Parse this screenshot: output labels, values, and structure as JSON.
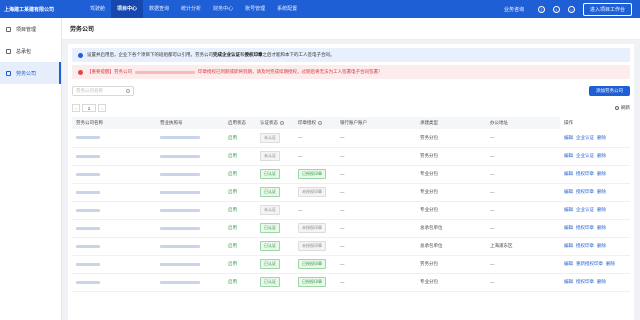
{
  "app": {
    "brand": "上海建工某建有限公司"
  },
  "topnav": [
    {
      "label": "驾驶舱",
      "active": false
    },
    {
      "label": "项目中心",
      "active": true
    },
    {
      "label": "数据查询",
      "active": false
    },
    {
      "label": "统计分析",
      "active": false
    },
    {
      "label": "财务中心",
      "active": false
    },
    {
      "label": "账号管理",
      "active": false
    },
    {
      "label": "系统配置",
      "active": false
    }
  ],
  "topright": {
    "link": "业务咨询",
    "enter_button": "进入项目工作台"
  },
  "sidebar": {
    "items": [
      {
        "label": "项目管理",
        "active": false
      },
      {
        "label": "总承包",
        "active": false
      },
      {
        "label": "劳务公司",
        "active": true
      }
    ]
  },
  "page": {
    "title": "劳务公司"
  },
  "alerts": {
    "info_pre": "设置并启用后，企业下各个项目下的班组都可以引用。劳务公司",
    "info_bold1": "完成企业认证",
    "info_mid": "和",
    "info_bold2": "授权印章",
    "info_post": "之后才能和本下的工人签电子合同。",
    "warn_pre": "【重要提醒】劳务公司",
    "warn_post": "印章授权已到期或即将到期，请及时完成续期授权，过期后将无法为工人签署电子合同签署！"
  },
  "toolbar": {
    "search_placeholder": "劳务公司名称",
    "add_button": "添加劳务公司"
  },
  "pager": {
    "page": "1"
  },
  "refresh": "刷新",
  "table": {
    "headers": [
      "劳务公司名称",
      "营业执照号",
      "启用状态",
      "认证状态",
      "印章授权",
      "银行账户账户",
      "承建类型",
      "办公地址",
      "操作"
    ],
    "rows": [
      {
        "status": "启用",
        "cert": "未认证",
        "seal": "---",
        "bank": "---",
        "type": "劳务分包",
        "addr": "---",
        "ops": [
          "编辑",
          "企业认证",
          "删除"
        ]
      },
      {
        "status": "启用",
        "cert": "未认证",
        "seal": "---",
        "bank": "---",
        "type": "劳务分包",
        "addr": "---",
        "ops": [
          "编辑",
          "企业认证",
          "删除"
        ]
      },
      {
        "status": "启用",
        "cert": "已认证",
        "seal": "已授权印章",
        "bank": "---",
        "type": "专业分包",
        "addr": "---",
        "ops": [
          "编辑",
          "授权印章",
          "删除"
        ]
      },
      {
        "status": "启用",
        "cert": "已认证",
        "seal": "未授权印章",
        "bank": "---",
        "type": "专业分包",
        "addr": "---",
        "ops": [
          "编辑",
          "授权印章",
          "删除"
        ]
      },
      {
        "status": "启用",
        "cert": "未认证",
        "seal": "---",
        "bank": "---",
        "type": "专业分包",
        "addr": "---",
        "ops": [
          "编辑",
          "企业认证",
          "删除"
        ]
      },
      {
        "status": "启用",
        "cert": "已认证",
        "seal": "未授权印章",
        "bank": "---",
        "type": "总承包单位",
        "addr": "---",
        "ops": [
          "编辑",
          "授权印章",
          "删除"
        ]
      },
      {
        "status": "启用",
        "cert": "已认证",
        "seal": "未授权印章",
        "bank": "---",
        "type": "总承包单位",
        "addr": "上海浦东区",
        "ops": [
          "编辑",
          "授权印章",
          "删除"
        ]
      },
      {
        "status": "启用",
        "cert": "已认证",
        "seal": "已授权印章",
        "bank": "---",
        "type": "劳务分包",
        "addr": "---",
        "ops": [
          "编辑",
          "重新授权印章",
          "删除"
        ]
      },
      {
        "status": "启用",
        "cert": "已认证",
        "seal": "已授权印章",
        "bank": "---",
        "type": "专业分包",
        "addr": "---",
        "ops": [
          "编辑",
          "授权印章",
          "删除"
        ]
      }
    ]
  },
  "colors": {
    "primary": "#1e5fd6",
    "success": "#2e9e3a",
    "danger": "#d9363e"
  },
  "icons": [
    "help-icon",
    "bell-icon",
    "user-icon",
    "search-icon",
    "refresh-icon",
    "info-icon",
    "warning-icon"
  ]
}
